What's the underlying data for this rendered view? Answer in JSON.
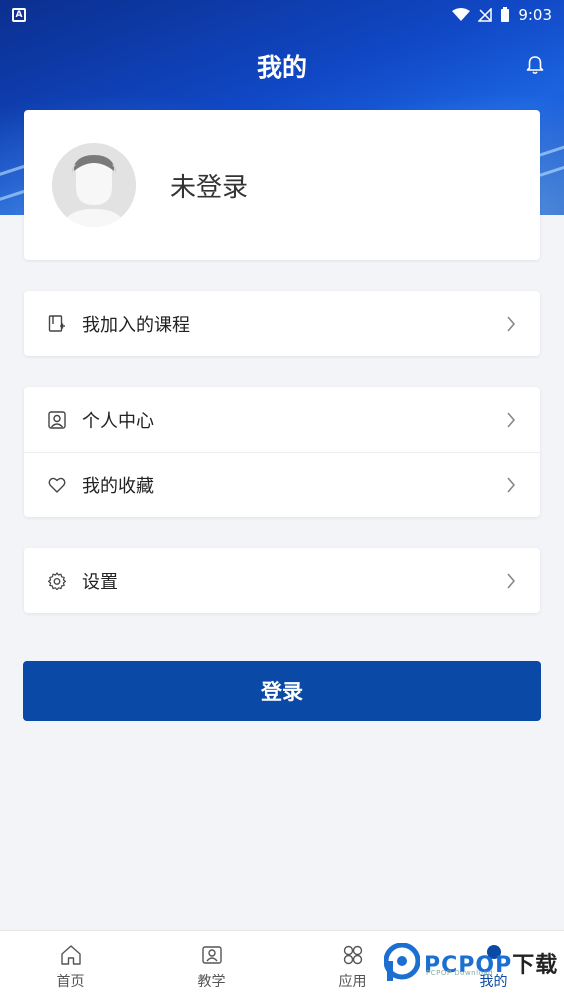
{
  "status_bar": {
    "time": "9:03"
  },
  "header": {
    "title": "我的"
  },
  "profile": {
    "name": "未登录"
  },
  "menu_groups": [
    {
      "items": [
        {
          "label": "我加入的课程",
          "icon": "course-icon"
        }
      ]
    },
    {
      "items": [
        {
          "label": "个人中心",
          "icon": "person-icon"
        },
        {
          "label": "我的收藏",
          "icon": "heart-icon"
        }
      ]
    },
    {
      "items": [
        {
          "label": "设置",
          "icon": "gear-icon"
        }
      ]
    }
  ],
  "login_button": {
    "label": "登录"
  },
  "tabs": [
    {
      "label": "首页",
      "icon": "home-icon"
    },
    {
      "label": "教学",
      "icon": "teach-icon"
    },
    {
      "label": "应用",
      "icon": "apps-icon"
    },
    {
      "label": "我的",
      "icon": "me-icon",
      "active": true
    }
  ],
  "watermark": {
    "text_blue": "PCPOP",
    "text_dark": "下载",
    "subtext": "PCPOP Download"
  },
  "colors": {
    "primary": "#0a4aa6",
    "header_gradient_start": "#0b2f8f",
    "background": "#f3f4f8"
  }
}
